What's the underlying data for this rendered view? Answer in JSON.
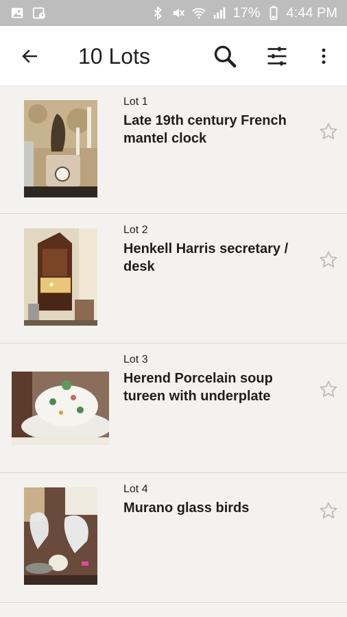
{
  "status_bar": {
    "battery_percent": "17%",
    "time": "4:44 PM",
    "icons": [
      "image-icon",
      "screenshot-icon",
      "bluetooth-icon",
      "mute-vibrate-icon",
      "wifi-icon",
      "signal-icon",
      "battery-icon"
    ]
  },
  "app_bar": {
    "title": "10 Lots",
    "icons": [
      "back-arrow-icon",
      "search-icon",
      "filter-sliders-icon",
      "more-vert-icon"
    ]
  },
  "lots": [
    {
      "number": "Lot 1",
      "title": "Late 19th century French mantel clock",
      "image": "mantel-clock-photo",
      "starred": false
    },
    {
      "number": "Lot 2",
      "title": "Henkell Harris secretary / desk",
      "image": "secretary-desk-photo",
      "starred": false
    },
    {
      "number": "Lot 3",
      "title": "Herend Porcelain soup tureen with underplate",
      "image": "soup-tureen-photo",
      "starred": false
    },
    {
      "number": "Lot 4",
      "title": "Murano glass birds",
      "image": "glass-birds-photo",
      "starred": false
    }
  ],
  "colors": {
    "status_bar": "#bdbdbd",
    "app_bar": "#ffffff",
    "list_background": "#f3f2ee",
    "star_outline": "#bdbdbd"
  }
}
